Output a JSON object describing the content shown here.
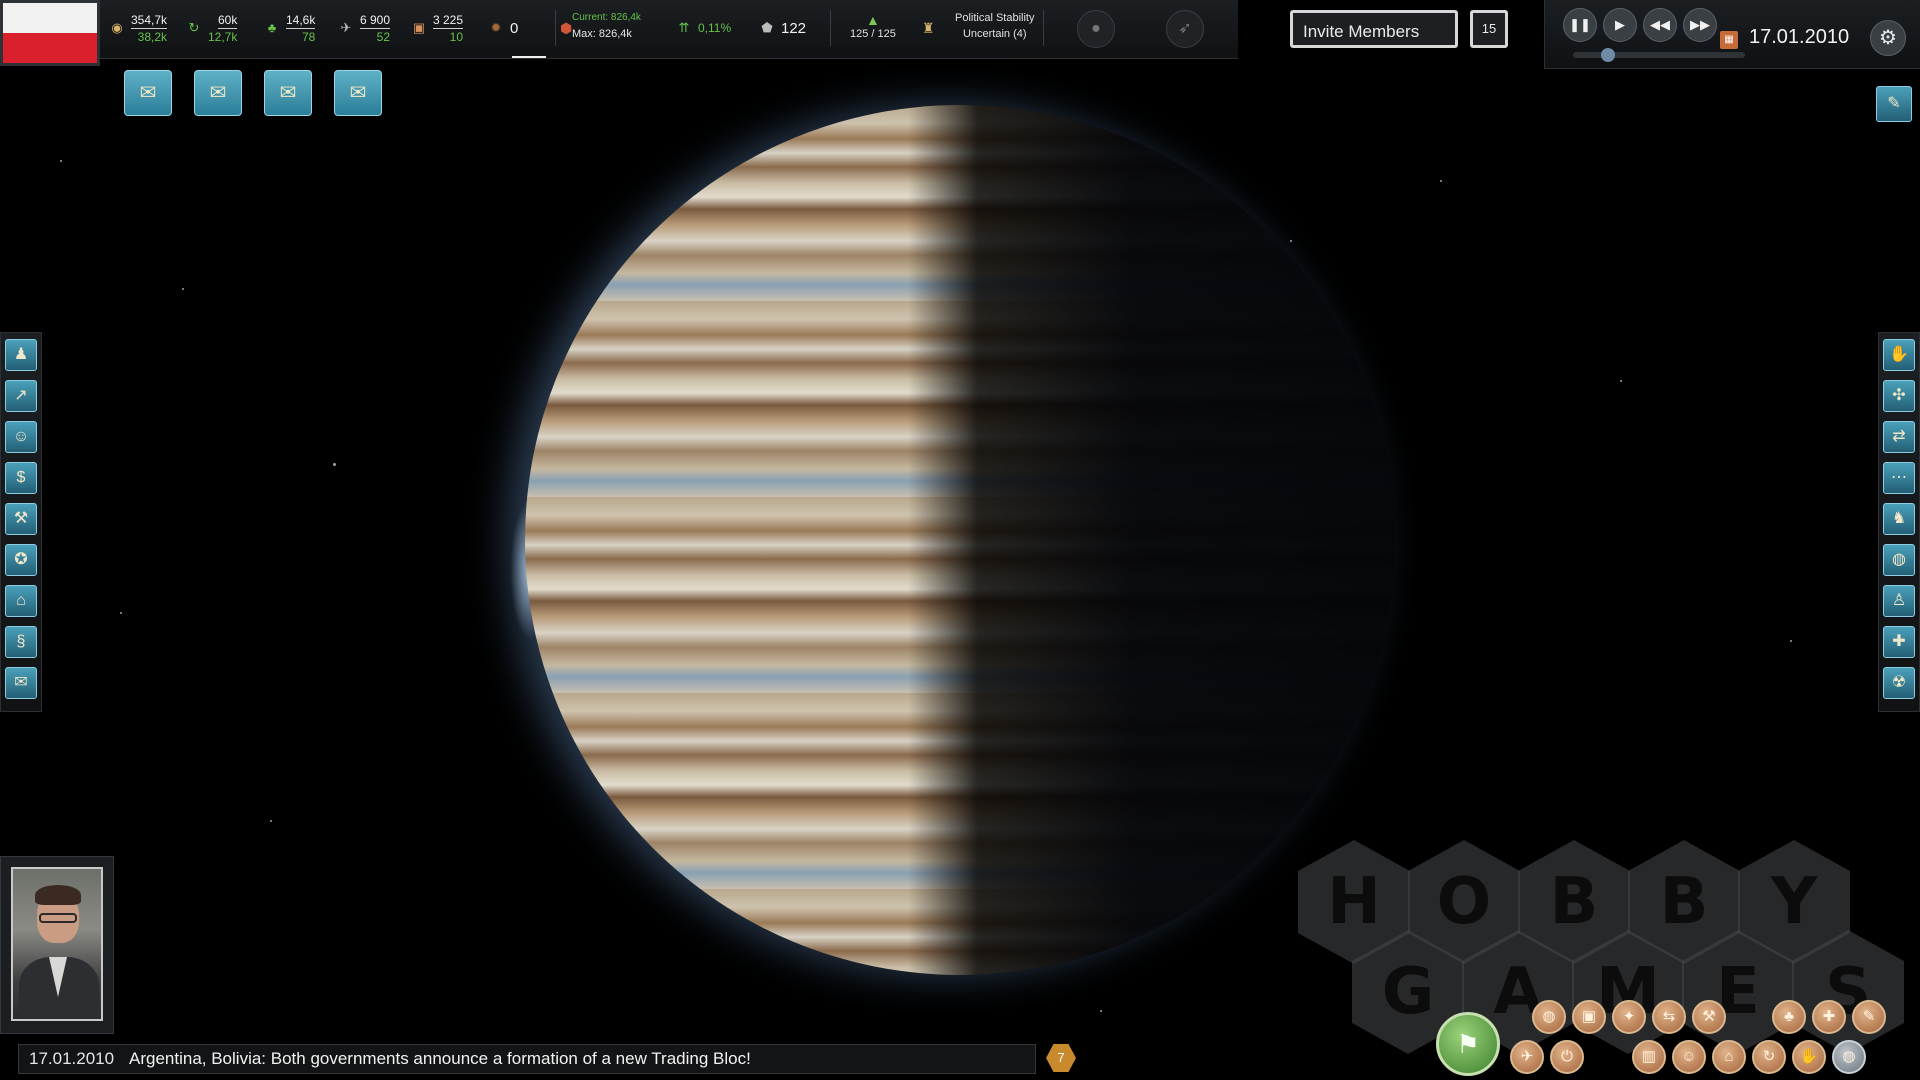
{
  "country": {
    "flag_colors": [
      "#f2f2f2",
      "#d9202c"
    ]
  },
  "resources": [
    {
      "name": "money",
      "icon": "coins-icon",
      "top": "354,7k",
      "bottom": "38,2k"
    },
    {
      "name": "research",
      "icon": "recycle-icon",
      "top": "60k",
      "bottom": "12,7k"
    },
    {
      "name": "agriculture",
      "icon": "plant-icon",
      "top": "14,6k",
      "bottom": "78"
    },
    {
      "name": "military",
      "icon": "jet-icon",
      "top": "6 900",
      "bottom": "52"
    },
    {
      "name": "goods",
      "icon": "crate-icon",
      "top": "3 225",
      "bottom": "10"
    }
  ],
  "resource_single": {
    "icon": "sun-icon",
    "value": "0"
  },
  "capacity": {
    "current": "Current: 826,4k",
    "max": "Max: 826,4k"
  },
  "growth": {
    "value": "0,11%"
  },
  "satisfaction": {
    "value": "122"
  },
  "population_ratio": {
    "value": "125 / 125"
  },
  "stability": {
    "title": "Political Stability",
    "status": "Uncertain (4)"
  },
  "invite": {
    "label": "Invite Members",
    "badge": "15"
  },
  "time": {
    "date": "17.01.2010"
  },
  "news": {
    "date": "17.01.2010",
    "message": "Argentina, Bolivia: Both governments announce a formation of a new Trading Bloc!",
    "count": "7"
  },
  "watermark": {
    "row1": [
      "H",
      "O",
      "B",
      "B",
      "Y"
    ],
    "row2": [
      "G",
      "A",
      "M",
      "E",
      "S"
    ]
  },
  "colors": {
    "positive": "#67c24b",
    "accent_button": "#3a8eaa"
  }
}
